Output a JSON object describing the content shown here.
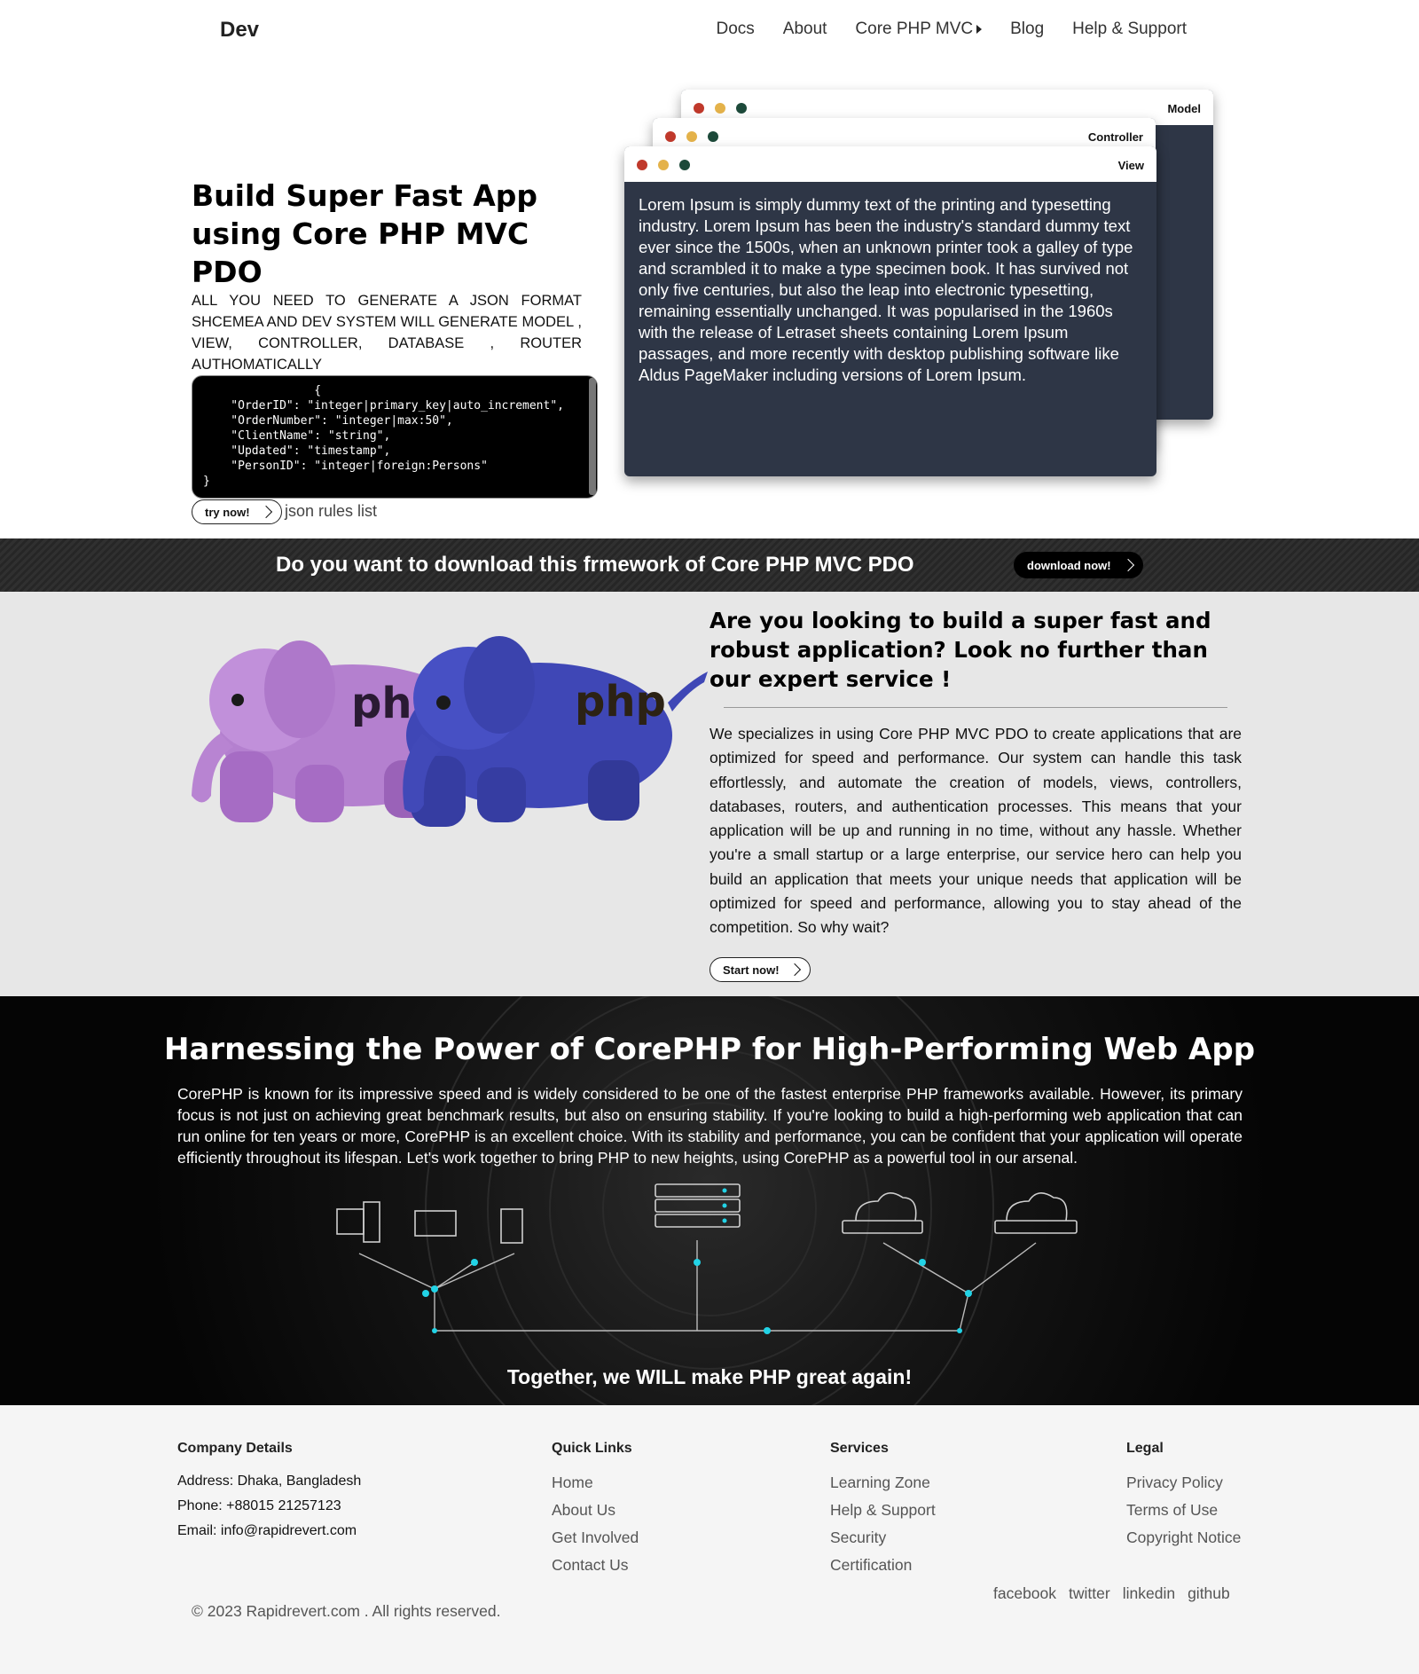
{
  "nav": {
    "brand": "Dev",
    "links": [
      "Docs",
      "About",
      "Core PHP MVC",
      "Blog",
      "Help & Support"
    ]
  },
  "hero": {
    "title": "Build Super Fast App using Core PHP MVC PDO",
    "subtitle": "ALL YOU NEED TO GENERATE A JSON FORMAT SHCEMEA AND DEV SYSTEM WILL GENERATE MODEL , VIEW, CONTROLLER, DATABASE , ROUTER AUTHOMATICALLY",
    "code": "                {\n    \"OrderID\": \"integer|primary_key|auto_increment\",\n    \"OrderNumber\": \"integer|max:50\",\n    \"ClientName\": \"string\",\n    \"Updated\": \"timestamp\",\n    \"PersonID\": \"integer|foreign:Persons\"\n}",
    "try_label": "try now!",
    "rules_label": "json rules list",
    "windows": {
      "model_title": "Model",
      "controller_title": "Controller",
      "view_title": "View",
      "view_body": "Lorem Ipsum is simply dummy text of the printing and typesetting industry. Lorem Ipsum has been the industry's standard dummy text ever since the 1500s, when an unknown printer took a galley of type and scrambled it to make a type specimen book. It has survived not only five centuries, but also the leap into electronic typesetting, remaining essentially unchanged. It was popularised in the 1960s with the release of Letraset sheets containing Lorem Ipsum passages, and more recently with desktop publishing software like Aldus PageMaker including versions of Lorem Ipsum."
    }
  },
  "download": {
    "text": "Do you want to download this frmework of Core PHP MVC PDO",
    "button": "download now!"
  },
  "service": {
    "title": "Are you looking to build a super fast and robust application? Look no further than our expert service !",
    "text": "We specializes in using Core PHP MVC PDO to create applications that are optimized for speed and performance. Our system can handle this task effortlessly, and automate the creation of models, views, controllers, databases, routers, and authentication processes. This means that your application will be up and running in no time, without any hassle. Whether you're a small startup or a large enterprise, our service hero can help you build an application that meets your unique needs that application will be optimized for speed and performance, allowing you to stay ahead of the competition. So why wait?",
    "button": "Start now!",
    "elephant_text": "php"
  },
  "power": {
    "title": "Harnessing the Power of CorePHP for High-Performing Web App",
    "text": "CorePHP is known for its impressive speed and is widely considered to be one of the fastest enterprise PHP frameworks available. However, its primary focus is not just on achieving great benchmark results, but also on ensuring stability. If you're looking to build a high-performing web application that can run online for ten years or more, CorePHP is an excellent choice. With its stability and performance, you can be confident that your application will operate efficiently throughout its lifespan. Let's work together to bring PHP to new heights, using CorePHP as a powerful tool in our arsenal.",
    "footer": "Together, we WILL make PHP great again!",
    "accent": "#22d3e6"
  },
  "footer": {
    "company": {
      "heading": "Company Details",
      "address": "Address: Dhaka, Bangladesh",
      "phone": "Phone: +88015 21257123",
      "email": "Email: info@rapidrevert.com"
    },
    "quick": {
      "heading": "Quick Links",
      "links": [
        "Home",
        "About Us",
        "Get Involved",
        "Contact Us"
      ]
    },
    "services": {
      "heading": "Services",
      "links": [
        "Learning Zone",
        "Help & Support",
        "Security",
        "Certification"
      ]
    },
    "legal": {
      "heading": "Legal",
      "links": [
        "Privacy Policy",
        "Terms of Use",
        "Copyright Notice"
      ]
    },
    "social": [
      "facebook",
      "twitter",
      "linkedin",
      "github"
    ],
    "copyright": "© 2023 Rapidrevert.com . All rights reserved."
  }
}
